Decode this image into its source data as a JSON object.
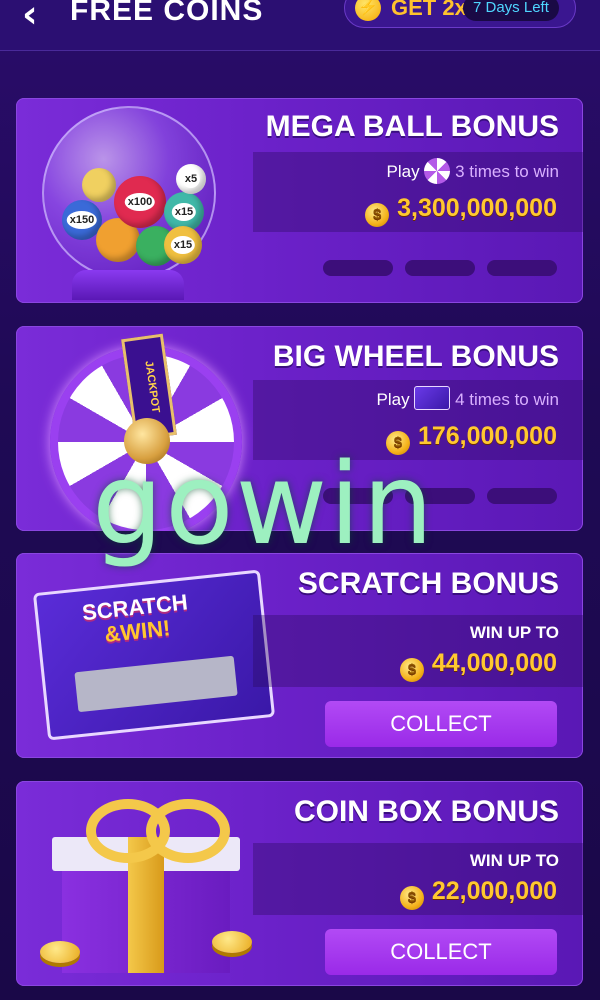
{
  "header": {
    "back_icon": "‹",
    "title": "FREE COINS",
    "boost_label": "GET 2x",
    "days_left": "7 Days Left"
  },
  "cards": [
    {
      "title": "MEGA BALL BONUS",
      "play_prefix": "Play",
      "play_count": "3 times to win",
      "amount": "3,300,000,000"
    },
    {
      "title": "BIG WHEEL BONUS",
      "play_prefix": "Play",
      "play_count": "4 times to win",
      "amount": "176,000,000",
      "wheel_label": "JACKPOT"
    },
    {
      "title": "SCRATCH BONUS",
      "win_label": "WIN UP TO",
      "amount": "44,000,000",
      "collect_label": "COLLECT",
      "scratch_line1": "SCRATCH",
      "scratch_line2": "&WIN!"
    },
    {
      "title": "COIN BOX BONUS",
      "win_label": "WIN UP TO",
      "amount": "22,000,000",
      "collect_label": "COLLECT"
    }
  ],
  "balls": [
    "x100",
    "x15",
    "x15",
    "x150",
    "x1",
    "x5"
  ],
  "watermark": "gowin",
  "colors": {
    "accent": "#ffc830",
    "card": "#6b21c9",
    "button": "#a83af0"
  }
}
